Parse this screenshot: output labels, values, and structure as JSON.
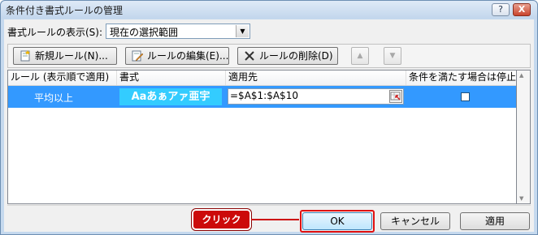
{
  "window": {
    "title": "条件付き書式ルールの管理",
    "help_label": "?",
    "close_label": "X"
  },
  "scope": {
    "label": "書式ルールの表示(S):",
    "selected": "現在の選択範囲"
  },
  "toolbar": {
    "new_rule": "新規ルール(N)...",
    "edit_rule": "ルールの編集(E)...",
    "delete_rule": "ルールの削除(D)"
  },
  "columns": {
    "rule": "ルール (表示順で適用)",
    "format": "書式",
    "applies_to": "適用先",
    "stop_if_true": "条件を満たす場合は停止"
  },
  "rules": [
    {
      "name": "平均以上",
      "format_preview": "Aaあぁアァ亜宇",
      "applies_to": "=$A$1:$A$10",
      "stop_if_true": false
    }
  ],
  "buttons": {
    "ok": "OK",
    "cancel": "キャンセル",
    "apply": "適用"
  },
  "annotation": {
    "callout": "クリック",
    "color": "#cc0a0a"
  },
  "colors": {
    "selection": "#3399ff",
    "format_preview_bg": "#33ccff"
  }
}
